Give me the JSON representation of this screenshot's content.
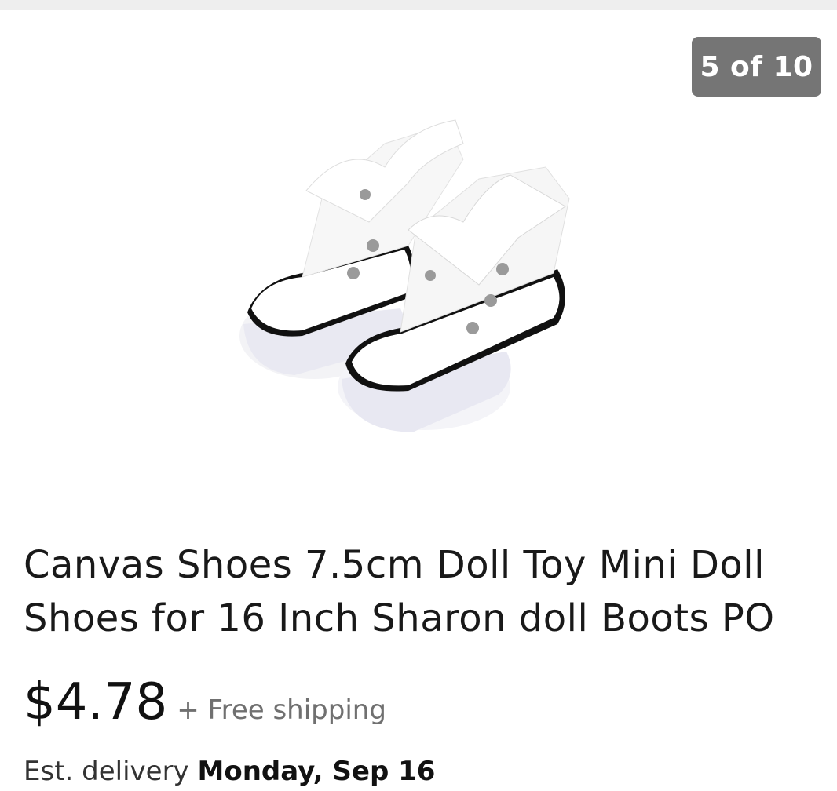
{
  "gallery": {
    "counter": "5 of 10",
    "image_alt": "white canvas doll shoes"
  },
  "product": {
    "title": "Canvas Shoes 7.5cm  Doll Toy Mini Doll Shoes for 16 Inch Sharon doll Boots PO",
    "price": "$4.78",
    "shipping": "+ Free shipping",
    "delivery_label": "Est. delivery",
    "delivery_date": "Monday, Sep 16"
  },
  "colors": {
    "counter_bg": "#757575",
    "top_strip": "#eeeeee",
    "shipping_text": "#707070"
  }
}
